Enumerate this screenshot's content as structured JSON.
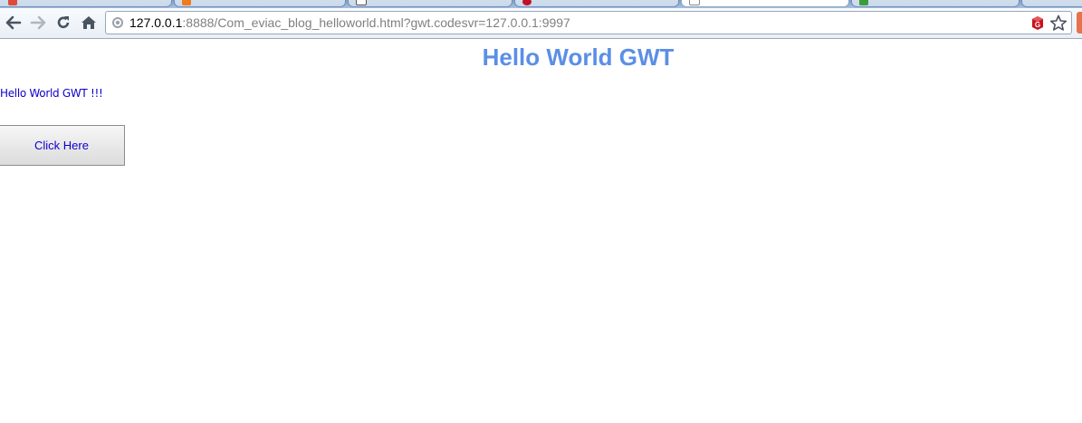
{
  "browser": {
    "url_host": "127.0.0.1",
    "url_rest": ":8888/Com_eviac_blog_helloworld.html?gwt.codesvr=127.0.0.1:9997",
    "icons": {
      "back": "back-arrow-icon",
      "forward": "forward-arrow-icon",
      "reload": "reload-icon",
      "home": "home-icon",
      "page_info": "globe-icon",
      "extension": "gwt-extension-icon",
      "bookmark": "star-icon"
    }
  },
  "page": {
    "title": "Hello World GWT",
    "text": "Hello World GWT !!!",
    "button_label": "Click Here"
  },
  "colors": {
    "title": "#5b8fe6",
    "text": "#1000cc",
    "button_text": "#1000cc"
  }
}
